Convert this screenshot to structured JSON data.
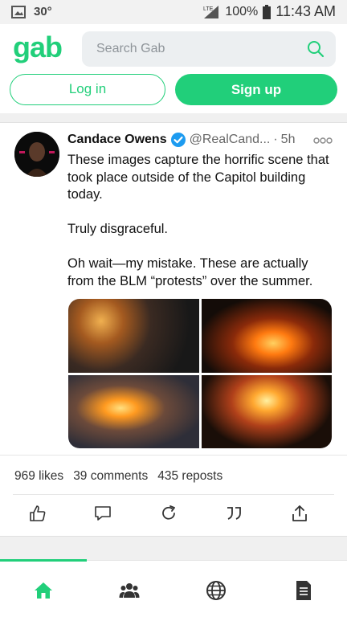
{
  "statusbar": {
    "temperature": "30°",
    "network": "LTE",
    "battery": "100%",
    "time": "11:43 AM"
  },
  "header": {
    "logo": "gab",
    "search_placeholder": "Search Gab",
    "login_label": "Log in",
    "signup_label": "Sign up"
  },
  "post": {
    "author": "Candace Owens",
    "handle": "@RealCand...",
    "separator": "·",
    "time": "5h",
    "paragraphs": [
      "These images capture the horrific scene that took place outside of the Capitol building today.",
      "Truly disgraceful.",
      "Oh wait—my mistake. These are actually from the BLM “protests” over the summer."
    ],
    "stats": {
      "likes": "969 likes",
      "comments": "39 comments",
      "reposts": "435 reposts"
    }
  },
  "colors": {
    "brand": "#21cf7a",
    "verified": "#1d9bf0"
  },
  "icons": {
    "statusbar": [
      "gallery-icon",
      "signal-icon",
      "battery-icon"
    ],
    "actions": [
      "like-icon",
      "comment-icon",
      "repost-icon",
      "quote-icon",
      "share-icon"
    ],
    "nav": [
      "home-icon",
      "groups-icon",
      "explore-icon",
      "news-icon"
    ]
  }
}
